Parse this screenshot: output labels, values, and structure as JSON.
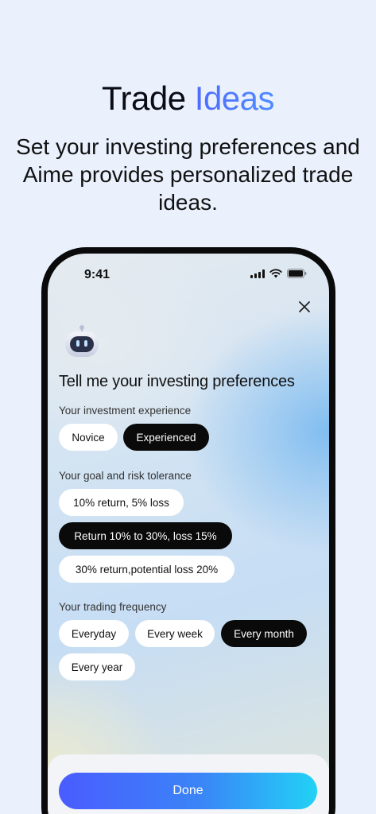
{
  "hero": {
    "title_plain": "Trade ",
    "title_accent": "Ideas",
    "subtitle": "Set your investing preferences and Aime provides personalized trade ideas."
  },
  "status_bar": {
    "time": "9:41"
  },
  "dialog": {
    "title": "Tell me your investing preferences",
    "experience": {
      "label": "Your investment experience",
      "options": [
        "Novice",
        "Experienced"
      ],
      "selected": "Experienced"
    },
    "goal": {
      "label": "Your goal and risk tolerance",
      "options": [
        "10% return, 5% loss",
        "Return 10% to 30%, loss 15%",
        "30% return,potential loss 20%"
      ],
      "selected": "Return 10% to 30%, loss 15%"
    },
    "frequency": {
      "label": "Your trading frequency",
      "options": [
        "Everyday",
        "Every week",
        "Every month",
        "Every year"
      ],
      "selected": "Every month"
    },
    "done_label": "Done"
  },
  "icons": {
    "close": "close-icon",
    "assistant": "robot-assistant-icon",
    "signal": "cellular-signal-icon",
    "wifi": "wifi-icon",
    "battery": "battery-icon"
  },
  "colors": {
    "accent": "#4f6bff",
    "selected_chip": "#0a0a0a",
    "done_gradient_start": "#4a5cff",
    "done_gradient_end": "#22d2f5"
  }
}
